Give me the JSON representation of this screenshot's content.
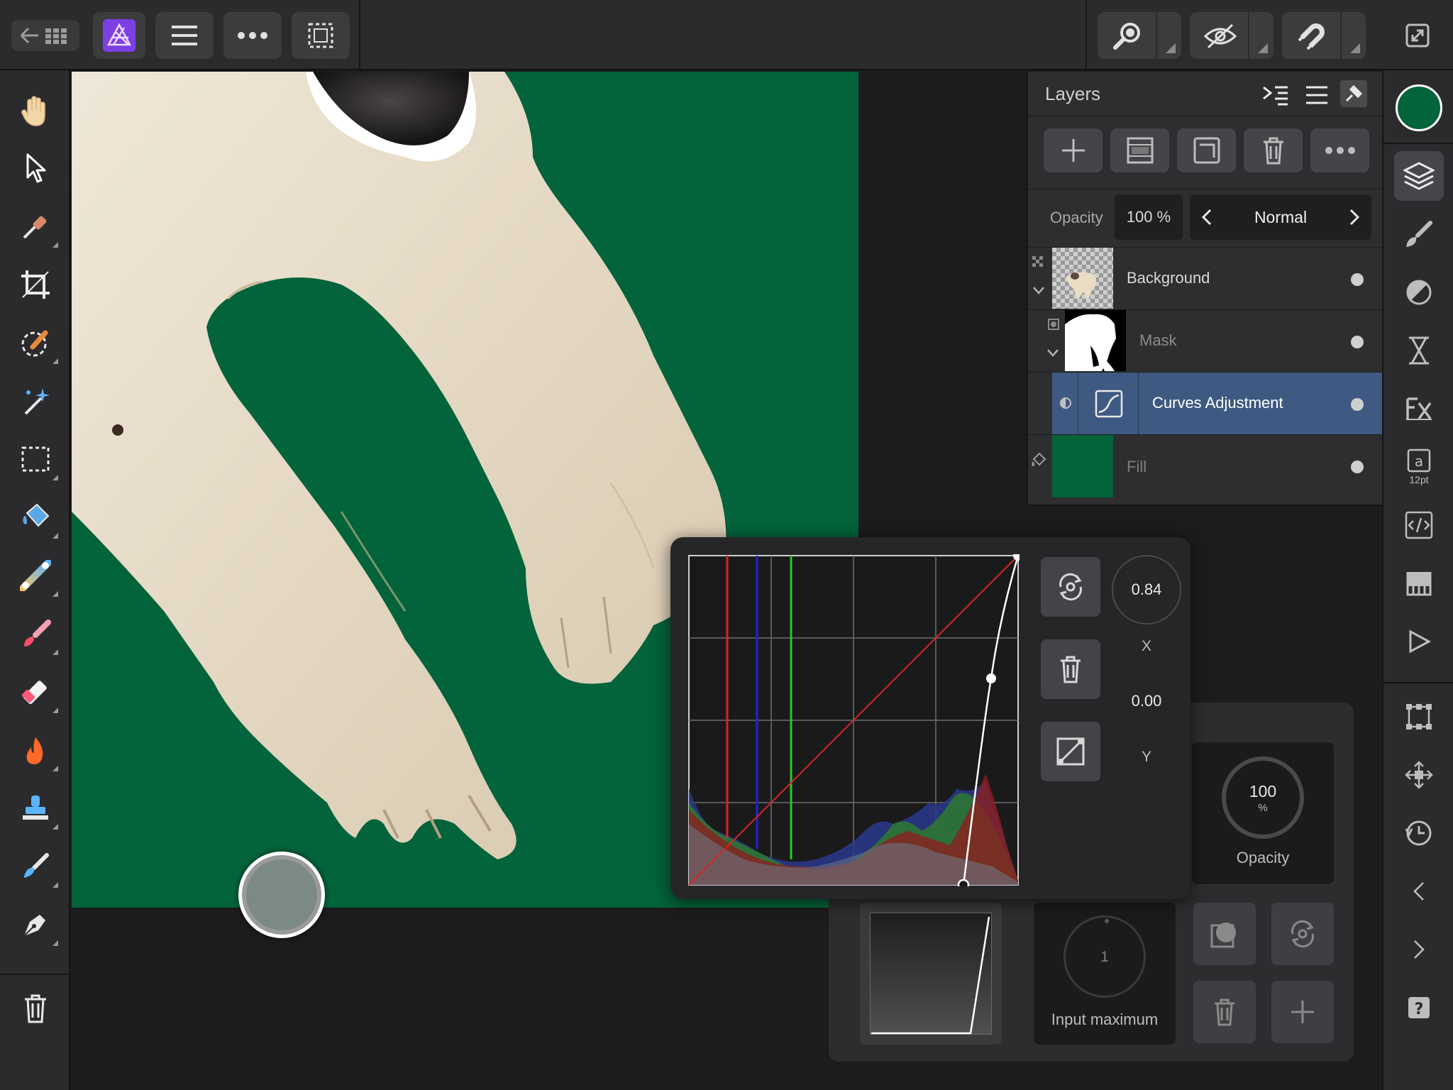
{
  "app": {
    "name": "Affinity Photo",
    "accent_color": "#8a4fff",
    "fill_color": "#03633a",
    "selection_color": "#3e5a82"
  },
  "topbar": {
    "left_buttons": [
      "back-to-gallery-icon",
      "affinity-photo-logo",
      "hamburger-menu-icon",
      "more-icon",
      "selection-icon"
    ],
    "right_buttons": [
      "zoom-search-icon",
      "view-quality-icon",
      "snapping-magnet-icon",
      "fullscreen-icon"
    ]
  },
  "tools": [
    "hand-icon",
    "move-pointer-icon",
    "color-picker-icon",
    "crop-icon",
    "selection-brush-icon",
    "magic-wand-icon",
    "marquee-icon",
    "flood-fill-icon",
    "gradient-icon",
    "paint-brush-icon",
    "erase-brush-icon",
    "burn-icon",
    "clone-stamp-icon",
    "smudge-icon",
    "pen-icon",
    "trash-icon"
  ],
  "studio": [
    "layers-icon",
    "brushes-icon",
    "adjustments-icon",
    "history-hourglass-icon",
    "fx-icon",
    "text-style-icon",
    "macro-icon",
    "channels-icon",
    "play-icon",
    "transform-icon",
    "navigator-icon",
    "history-icon",
    "chevron-left-icon",
    "chevron-right-icon",
    "help-icon"
  ],
  "studio_text_size": "12pt",
  "layers": {
    "title": "Layers",
    "opacity_label": "Opacity",
    "opacity_value": "100 %",
    "blend_mode": "Normal",
    "items": [
      {
        "name": "Background",
        "type": "pixel"
      },
      {
        "name": "Mask",
        "type": "mask"
      },
      {
        "name": "Curves Adjustment",
        "type": "curves",
        "selected": true
      },
      {
        "name": "Fill",
        "type": "fill"
      }
    ]
  },
  "curves": {
    "x_value": "0.84",
    "x_label": "X",
    "y_value": "0.00",
    "y_label": "Y"
  },
  "context": {
    "opacity_value": "100",
    "opacity_unit": "%",
    "opacity_label": "Opacity",
    "input_max_value": "1",
    "input_max_label": "Input maximum"
  }
}
